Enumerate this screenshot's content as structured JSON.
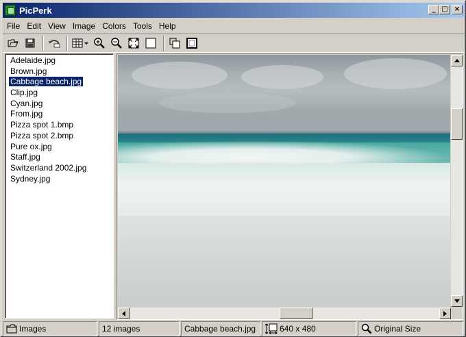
{
  "window": {
    "title": "PicPerk"
  },
  "title_buttons": {
    "minimize": "_",
    "maximize": "□",
    "close": "×"
  },
  "menu": [
    {
      "label": "File"
    },
    {
      "label": "Edit"
    },
    {
      "label": "View"
    },
    {
      "label": "Image"
    },
    {
      "label": "Colors"
    },
    {
      "label": "Tools"
    },
    {
      "label": "Help"
    }
  ],
  "toolbar": {
    "buttons": [
      "open-icon",
      "save-icon",
      "undo-icon",
      "thumbnails-icon",
      "zoom-in-icon",
      "zoom-out-icon",
      "fit-window-icon",
      "fullscreen-icon",
      "copy-icon",
      "crop-icon"
    ]
  },
  "files": {
    "items": [
      "Adelaide.jpg",
      "Brown.jpg",
      "Cabbage beach.jpg",
      "Clip.jpg",
      "Cyan.jpg",
      "From.jpg",
      "Pizza spot 1.bmp",
      "Pizza spot 2.bmp",
      "Pure ox.jpg",
      "Staff.jpg",
      "Switzerland 2002.jpg",
      "Sydney.jpg"
    ],
    "selected_index": 2
  },
  "status": {
    "folder": "Images",
    "count": "12 images",
    "filename": "Cabbage beach.jpg",
    "dimensions": "640 x 480",
    "zoom": "Original Size"
  },
  "colors": {
    "titlebar_start": "#0a246a",
    "titlebar_end": "#a6caf0",
    "selection": "#0a246a",
    "face": "#d4d0c8"
  }
}
